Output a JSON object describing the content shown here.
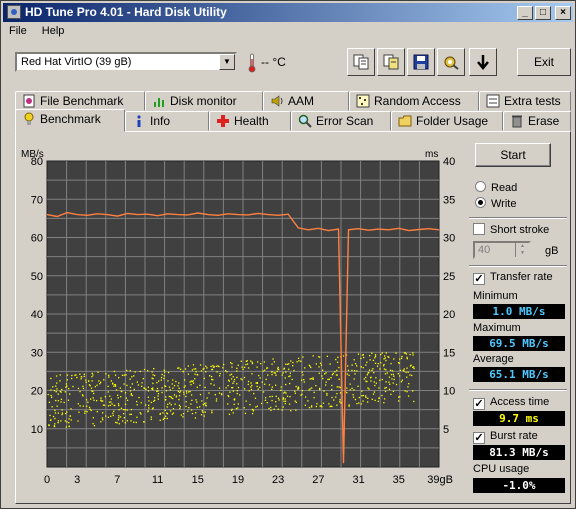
{
  "window": {
    "title": "HD Tune Pro 4.01 - Hard Disk Utility",
    "controls": [
      "_",
      "□",
      "×"
    ]
  },
  "menu": [
    "File",
    "Help"
  ],
  "toolbar": {
    "drive": "Red Hat VirtIO (39 gB)",
    "temperature": "-- °C",
    "exit_label": "Exit",
    "icons": [
      "copy-info-icon",
      "copy-screen-icon",
      "save-icon",
      "options-icon",
      "download-icon"
    ]
  },
  "tabs_top": [
    {
      "label": "File Benchmark",
      "icon": "file-benchmark-icon"
    },
    {
      "label": "Disk monitor",
      "icon": "disk-monitor-icon"
    },
    {
      "label": "AAM",
      "icon": "speaker-icon"
    },
    {
      "label": "Random Access",
      "icon": "random-access-icon"
    },
    {
      "label": "Extra tests",
      "icon": "extra-tests-icon"
    }
  ],
  "tabs_bottom": [
    {
      "label": "Benchmark",
      "icon": "benchmark-icon",
      "active": true
    },
    {
      "label": "Info",
      "icon": "info-icon"
    },
    {
      "label": "Health",
      "icon": "health-icon"
    },
    {
      "label": "Error Scan",
      "icon": "magnifier-icon"
    },
    {
      "label": "Folder Usage",
      "icon": "folder-icon"
    },
    {
      "label": "Erase",
      "icon": "trash-icon"
    }
  ],
  "panel": {
    "start_label": "Start",
    "read_label": "Read",
    "write_label": "Write",
    "mode": "write",
    "short_stroke_label": "Short stroke",
    "short_stroke_checked": false,
    "short_stroke_value": "40",
    "short_stroke_unit": "gB",
    "transfer_rate_label": "Transfer rate",
    "transfer_rate_checked": true,
    "minimum_label": "Minimum",
    "minimum_value": "1.0 MB/s",
    "maximum_label": "Maximum",
    "maximum_value": "69.5 MB/s",
    "average_label": "Average",
    "average_value": "65.1 MB/s",
    "access_time_label": "Access time",
    "access_time_checked": true,
    "access_time_value": "9.7 ms",
    "burst_rate_label": "Burst rate",
    "burst_rate_checked": true,
    "burst_rate_value": "81.3 MB/s",
    "cpu_usage_label": "CPU usage",
    "cpu_usage_value": "-1.0%"
  },
  "chart_data": {
    "type": "line",
    "left_unit": "MB/s",
    "right_unit": "ms",
    "ylim_left": [
      0,
      80
    ],
    "ylim_right": [
      0,
      40
    ],
    "xlim": [
      0,
      39
    ],
    "x_ticks": [
      "0",
      "3",
      "7",
      "11",
      "15",
      "19",
      "23",
      "27",
      "31",
      "35",
      "39gB"
    ],
    "y_ticks_left": [
      "10",
      "20",
      "30",
      "40",
      "50",
      "60",
      "70",
      "80"
    ],
    "y_ticks_right": [
      "5",
      "10",
      "15",
      "20",
      "25",
      "30",
      "35",
      "40"
    ],
    "grid": true,
    "colors": {
      "transfer": "#ff8040",
      "access": "#ffff00",
      "background": "#404040",
      "grid": "#808080"
    },
    "series": [
      {
        "kind": "transfer_rate",
        "x": [
          0,
          1,
          2,
          3,
          4,
          5,
          6,
          7,
          8,
          9,
          10,
          11,
          12,
          13,
          14,
          15,
          16,
          17,
          18,
          19,
          20,
          21,
          22,
          23,
          24,
          25,
          26,
          27,
          28,
          29,
          29.5,
          30,
          31,
          32,
          33,
          34,
          35,
          36,
          37,
          38,
          39
        ],
        "y": [
          66,
          65.5,
          66.5,
          66,
          65.8,
          66.2,
          66,
          65.6,
          66.3,
          66,
          66.1,
          65.7,
          66.2,
          66,
          65.9,
          66.4,
          66,
          65.8,
          66.2,
          66,
          65.9,
          66.3,
          66,
          65.8,
          66.1,
          62.5,
          62,
          62.4,
          61.8,
          62.2,
          1,
          62,
          62.3,
          61.9,
          62.2,
          62,
          62.4,
          61.8,
          62.1,
          62.3,
          62
        ]
      },
      {
        "kind": "access_time",
        "x_range": [
          0,
          36.5
        ],
        "y_range_ms": [
          5,
          15
        ],
        "count": 900
      }
    ]
  }
}
